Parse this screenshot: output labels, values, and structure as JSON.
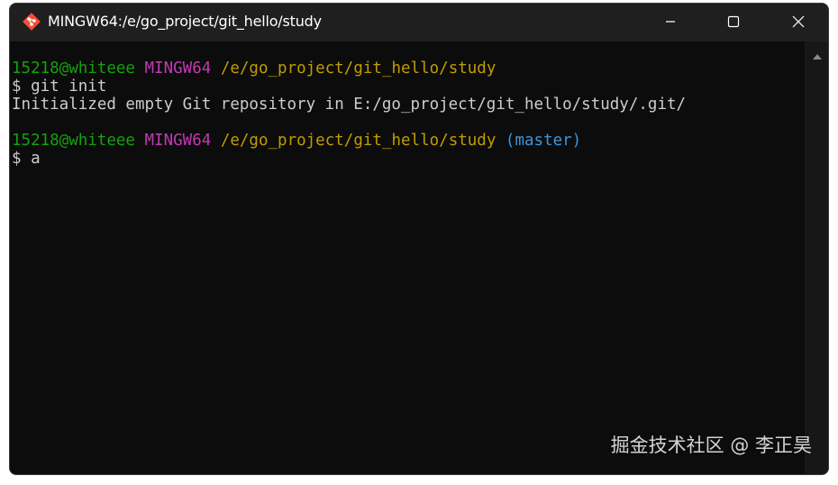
{
  "window": {
    "title": "MINGW64:/e/go_project/git_hello/study",
    "app_icon": "git-diamond-icon",
    "controls": {
      "minimize": "minimize-icon",
      "maximize": "maximize-icon",
      "close": "close-icon"
    }
  },
  "terminal": {
    "prompt1": {
      "user": "15218@whiteee",
      "host": "MINGW64",
      "path": "/e/go_project/git_hello/study"
    },
    "command1": "$ git init",
    "output1": "Initialized empty Git repository in E:/go_project/git_hello/study/.git/",
    "prompt2": {
      "user": "15218@whiteee",
      "host": "MINGW64",
      "path": "/e/go_project/git_hello/study",
      "branch": "(master)"
    },
    "command2": "$ a"
  },
  "watermark": "掘金技术社区 @ 李正昊",
  "colors": {
    "user": "#13a10e",
    "host": "#c239b3",
    "path": "#c19c00",
    "branch": "#3a96dd",
    "text": "#cccccc",
    "background": "#0c0c0c",
    "titlebar": "#1f1f1f"
  }
}
